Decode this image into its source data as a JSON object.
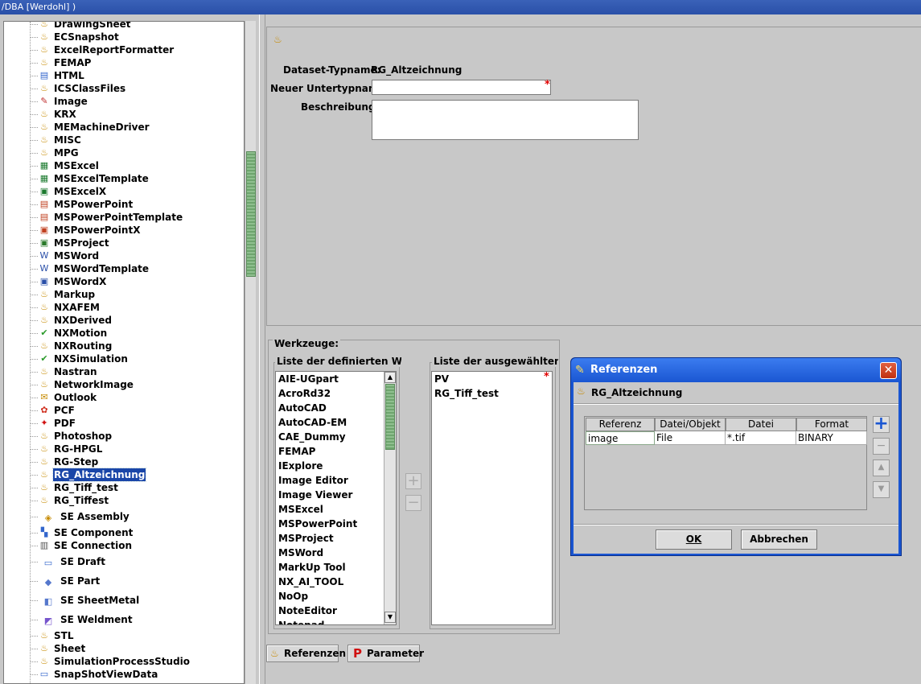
{
  "window": {
    "title": "/DBA   [Werdohl] )"
  },
  "tree": {
    "selected": "RG_Altzeichnung",
    "items": [
      {
        "label": "DrawingSheet",
        "icon": "gear-icon"
      },
      {
        "label": "ECSnapshot",
        "icon": "gear-icon"
      },
      {
        "label": "ExcelReportFormatter",
        "icon": "gear-icon"
      },
      {
        "label": "FEMAP",
        "icon": "gear-icon"
      },
      {
        "label": "HTML",
        "icon": "html-doc-icon"
      },
      {
        "label": "ICSClassFiles",
        "icon": "gear-icon"
      },
      {
        "label": "Image",
        "icon": "image-brush-icon"
      },
      {
        "label": "KRX",
        "icon": "gear-icon"
      },
      {
        "label": "MEMachineDriver",
        "icon": "gear-icon"
      },
      {
        "label": "MISC",
        "icon": "gear-icon"
      },
      {
        "label": "MPG",
        "icon": "gear-icon"
      },
      {
        "label": "MSExcel",
        "icon": "excel-icon"
      },
      {
        "label": "MSExcelTemplate",
        "icon": "excel-template-icon"
      },
      {
        "label": "MSExcelX",
        "icon": "excelx-icon"
      },
      {
        "label": "MSPowerPoint",
        "icon": "powerpoint-icon"
      },
      {
        "label": "MSPowerPointTemplate",
        "icon": "powerpoint-template-icon"
      },
      {
        "label": "MSPowerPointX",
        "icon": "powerpointx-icon"
      },
      {
        "label": "MSProject",
        "icon": "project-icon"
      },
      {
        "label": "MSWord",
        "icon": "word-icon"
      },
      {
        "label": "MSWordTemplate",
        "icon": "word-template-icon"
      },
      {
        "label": "MSWordX",
        "icon": "wordx-icon"
      },
      {
        "label": "Markup",
        "icon": "gear-icon"
      },
      {
        "label": "NXAFEM",
        "icon": "gear-icon"
      },
      {
        "label": "NXDerived",
        "icon": "gear-icon"
      },
      {
        "label": "NXMotion",
        "icon": "nx-check-icon"
      },
      {
        "label": "NXRouting",
        "icon": "gear-icon"
      },
      {
        "label": "NXSimulation",
        "icon": "nx-check-icon"
      },
      {
        "label": "Nastran",
        "icon": "gear-icon"
      },
      {
        "label": "NetworkImage",
        "icon": "gear-icon"
      },
      {
        "label": "Outlook",
        "icon": "outlook-icon"
      },
      {
        "label": "PCF",
        "icon": "pcf-icon"
      },
      {
        "label": "PDF",
        "icon": "pdf-icon"
      },
      {
        "label": "Photoshop",
        "icon": "gear-icon"
      },
      {
        "label": "RG-HPGL",
        "icon": "gear-icon"
      },
      {
        "label": "RG-Step",
        "icon": "gear-icon"
      },
      {
        "label": "RG_Altzeichnung",
        "icon": "gear-icon"
      },
      {
        "label": "RG_Tiff_test",
        "icon": "gear-icon"
      },
      {
        "label": "RG_Tiffest",
        "icon": "gear-icon"
      },
      {
        "label": "SE Assembly",
        "icon": "se-assembly-icon"
      },
      {
        "label": "SE Component",
        "icon": "se-component-icon"
      },
      {
        "label": "SE Connection",
        "icon": "se-connection-icon"
      },
      {
        "label": "SE Draft",
        "icon": "se-draft-icon"
      },
      {
        "label": "SE Part",
        "icon": "se-part-icon"
      },
      {
        "label": "SE SheetMetal",
        "icon": "se-sheetmetal-icon"
      },
      {
        "label": "SE Weldment",
        "icon": "se-weldment-icon"
      },
      {
        "label": "STL",
        "icon": "gear-icon"
      },
      {
        "label": "Sheet",
        "icon": "gear-icon"
      },
      {
        "label": "SimulationProcessStudio",
        "icon": "gear-icon"
      },
      {
        "label": "SnapShotViewData",
        "icon": "snapshot-icon"
      },
      {
        "label": "",
        "icon": "gear-icon"
      }
    ]
  },
  "form": {
    "dataset_type_label": "Dataset-Typname:",
    "dataset_type_value": "RG_Altzeichnung",
    "new_subtype_label": "Neuer Untertypname:",
    "new_subtype_value": "",
    "description_label": "Beschreibung:",
    "description_value": "",
    "required_mark": "*"
  },
  "tools": {
    "title": "Werkzeuge:",
    "defined_title": "Liste der definierten Werkz",
    "defined": [
      "AIE-UGpart",
      "AcroRd32",
      "AutoCAD",
      "AutoCAD-EM",
      "CAE_Dummy",
      "FEMAP",
      "IExplore",
      "Image Editor",
      "Image Viewer",
      "MSExcel",
      "MSPowerPoint",
      "MSProject",
      "MSWord",
      "MarkUp Tool",
      "NX_AI_TOOL",
      "NoOp",
      "NoteEditor",
      "Notepad"
    ],
    "selected_title": "Liste der ausgewählten We",
    "selected": [
      "PV",
      "RG_Tiff_test"
    ],
    "add_symbol": "+",
    "remove_symbol": "−"
  },
  "bottom_buttons": {
    "references": "Referenzen",
    "parameters": "Parameter"
  },
  "dialog": {
    "title": "Referenzen",
    "subtitle": "RG_Altzeichnung",
    "columns": [
      "Referenz",
      "Datei/Objekt",
      "Datei",
      "Format"
    ],
    "rows": [
      [
        "image",
        "File",
        "*.tif",
        "BINARY"
      ]
    ],
    "ok_label": "OK",
    "cancel_label": "Abbrechen"
  }
}
